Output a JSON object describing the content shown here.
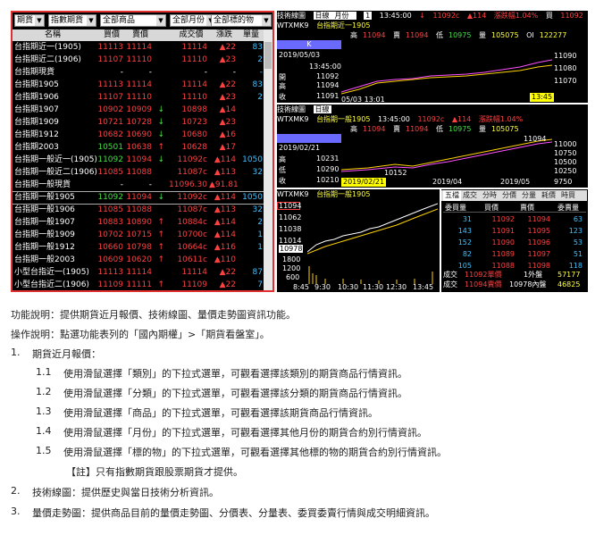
{
  "quote_panel": {
    "dropdowns": [
      "期貨",
      "指數期貨",
      "全部商品",
      "全部月份",
      "全部標的物"
    ],
    "headers": [
      "名稱",
      "買價",
      "賣價",
      "",
      "成交價",
      "漲跌",
      "單量"
    ],
    "rows": [
      {
        "name": "台指期近一(1905)",
        "bid": "11113",
        "ask": "11114",
        "dir": "",
        "last": "11114",
        "chg": "▲22",
        "vol": "83"
      },
      {
        "name": "台指期近二(1906)",
        "bid": "11107",
        "ask": "11110",
        "dir": "",
        "last": "11110",
        "chg": "▲23",
        "vol": "2"
      },
      {
        "name": "台指期現貨",
        "bid": "-",
        "ask": "-",
        "dir": "",
        "last": "-",
        "chg": "-",
        "vol": "-"
      },
      {
        "name": "台指期1905",
        "bid": "11113",
        "ask": "11114",
        "dir": "",
        "last": "11114",
        "chg": "▲22",
        "vol": "83"
      },
      {
        "name": "台指期1906",
        "bid": "11107",
        "ask": "11110",
        "dir": "",
        "last": "11110",
        "chg": "▲23",
        "vol": "2"
      },
      {
        "name": "台指期1907",
        "bid": "10902",
        "ask": "10909",
        "dir": "↓",
        "last": "10898",
        "chg": "▲14",
        "vol": ""
      },
      {
        "name": "台指期1909",
        "bid": "10721",
        "ask": "10728",
        "dir": "↓",
        "last": "10723",
        "chg": "▲23",
        "vol": ""
      },
      {
        "name": "台指期1912",
        "bid": "10682",
        "ask": "10690",
        "dir": "↓",
        "last": "10680",
        "chg": "▲16",
        "vol": ""
      },
      {
        "name": "台指期2003",
        "bid": "10501",
        "ask": "10638",
        "dir": "↑",
        "last": "10628",
        "chg": "▲17",
        "vol": ""
      },
      {
        "name": "台指期一般近一(1905)",
        "bid": "11092",
        "ask": "11094",
        "dir": "↓",
        "last": "11092c",
        "chg": "▲114",
        "vol": "1050"
      },
      {
        "name": "台指期一般近二(1906)",
        "bid": "11085",
        "ask": "11088",
        "dir": "",
        "last": "11087c",
        "chg": "▲113",
        "vol": "32"
      },
      {
        "name": "台指期一般現貨",
        "bid": "-",
        "ask": "-",
        "dir": "",
        "last": "11096.30",
        "chg": "▲91.81",
        "vol": ""
      },
      {
        "name": "台指期一般1905",
        "bid": "11092",
        "ask": "11094",
        "dir": "↓",
        "last": "11092c",
        "chg": "▲114",
        "vol": "1050"
      },
      {
        "name": "台指期一般1906",
        "bid": "11085",
        "ask": "11088",
        "dir": "",
        "last": "11087c",
        "chg": "▲113",
        "vol": "32"
      },
      {
        "name": "台指期一般1907",
        "bid": "10883",
        "ask": "10890",
        "dir": "↑",
        "last": "10884c",
        "chg": "▲114",
        "vol": "2"
      },
      {
        "name": "台指期一般1909",
        "bid": "10702",
        "ask": "10715",
        "dir": "↑",
        "last": "10700c",
        "chg": "▲114",
        "vol": "1"
      },
      {
        "name": "台指期一般1912",
        "bid": "10660",
        "ask": "10798",
        "dir": "↑",
        "last": "10664c",
        "chg": "▲116",
        "vol": "1"
      },
      {
        "name": "台指期一般2003",
        "bid": "10609",
        "ask": "10620",
        "dir": "↑",
        "last": "10611c",
        "chg": "▲110",
        "vol": ""
      },
      {
        "name": "小型台指近一(1905)",
        "bid": "11113",
        "ask": "11114",
        "dir": "",
        "last": "11114",
        "chg": "▲22",
        "vol": "87"
      },
      {
        "name": "小型台指近二(1906)",
        "bid": "11109",
        "ask": "11111",
        "dir": "↑",
        "last": "11109",
        "chg": "▲22",
        "vol": "7"
      }
    ]
  },
  "chart1": {
    "bar_label": "技術線圖",
    "period": "日線",
    "month": "月份",
    "num": "1",
    "code": "WTXMK9",
    "name": "台指期近一1905",
    "info": [
      "13:45:00",
      "↓",
      "11092c",
      "▲114",
      "漲跌幅1.04%",
      "買",
      "11092"
    ],
    "info2": [
      "高",
      "11094",
      "賣",
      "11094",
      "低",
      "10975",
      "量",
      "105075",
      "OI",
      "122277"
    ],
    "k": "K",
    "date": "2019/05/03",
    "time": "13:45:00",
    "side": [
      "開",
      "11092",
      "高",
      "11094",
      "低",
      "11070",
      "收",
      "11091"
    ],
    "cursor": "05/03 13:01",
    "end_time": "13:45",
    "yticks": [
      "11090",
      "11080",
      "11070"
    ]
  },
  "chart2": {
    "bar_label": "技術線圖",
    "period": "日線",
    "code": "WTXMK9",
    "name": "台指期一般1905",
    "info": [
      "13:45:00",
      "↓",
      "11092c",
      "▲114",
      "漲跌幅1.04%",
      "買",
      "11092"
    ],
    "info2": [
      "高",
      "11094",
      "賣",
      "11094",
      "低",
      "10975",
      "量",
      "105075",
      "OI",
      "122277"
    ],
    "date": "2019/02/21",
    "side": [
      "高",
      "10231",
      "低",
      "10290",
      "收",
      "10210"
    ],
    "peak": "11094",
    "low": "10152",
    "xticks": [
      "2019/02/21",
      "2019/04",
      "2019/05"
    ],
    "yticks": [
      "11000",
      "10750",
      "10500",
      "10250",
      "9750"
    ]
  },
  "chart3": {
    "code": "WTXMK9",
    "name": "台指期一般1905",
    "yticks": [
      "11094",
      "11062",
      "11038",
      "11014",
      "10978"
    ],
    "vticks": [
      "1800",
      "1200",
      "600"
    ],
    "xticks": [
      "8:45",
      "9:30",
      "10:30",
      "11:30",
      "12:30",
      "13:45"
    ]
  },
  "orderbook": {
    "tabs": [
      "五檔",
      "成交",
      "分時",
      "分價",
      "分量",
      "耗價",
      "時買"
    ],
    "headers": [
      "委買量",
      "買價",
      "賣價",
      "委賣量"
    ],
    "rows": [
      [
        "31",
        "11092",
        "11094",
        "63"
      ],
      [
        "143",
        "11091",
        "11095",
        "123"
      ],
      [
        "152",
        "11090",
        "11096",
        "53"
      ],
      [
        "82",
        "11089",
        "11097",
        "51"
      ],
      [
        "105",
        "11088",
        "11098",
        "118"
      ]
    ],
    "summary1": [
      "成交",
      "11092單價",
      "1外盤",
      "57177"
    ],
    "summary2": [
      "成交",
      "11094賣價",
      "10978內盤",
      "46825"
    ]
  },
  "text": {
    "func": "功能說明：提供期貨近月報價、技術線圖、量價走勢圖資訊功能。",
    "op": "操作說明：點選功能表列的「國內期權」>「期貨看盤室」。",
    "items": [
      {
        "num": "1.",
        "text": "期貨近月報價："
      },
      {
        "num": "1.1",
        "text": "使用滑鼠選擇「類別」的下拉式選單，可觀看選擇該類別的期貨商品行情資訊。"
      },
      {
        "num": "1.2",
        "text": "使用滑鼠選擇「分類」的下拉式選單，可觀看選擇該分類的期貨商品行情資訊。"
      },
      {
        "num": "1.3",
        "text": "使用滑鼠選擇「商品」的下拉式選單，可觀看選擇該期貨商品行情資訊。"
      },
      {
        "num": "1.4",
        "text": "使用滑鼠選擇「月份」的下拉式選單，可觀看選擇其他月份的期貨合約別行情資訊。"
      },
      {
        "num": "1.5",
        "text": "使用滑鼠選擇「標的物」的下拉式選單，可觀看選擇其他標的物的期貨合約別行情資訊。"
      },
      {
        "num": "",
        "text": "【註】只有指數期貨跟股票期貨才提供。"
      },
      {
        "num": "2.",
        "text": "技術線圖：提供歷史與當日技術分析資訊。"
      },
      {
        "num": "3.",
        "text": "量價走勢圖：提供商品目前的量價走勢圖、分價表、分量表、委買委賣行情與成交明細資訊。"
      }
    ]
  }
}
